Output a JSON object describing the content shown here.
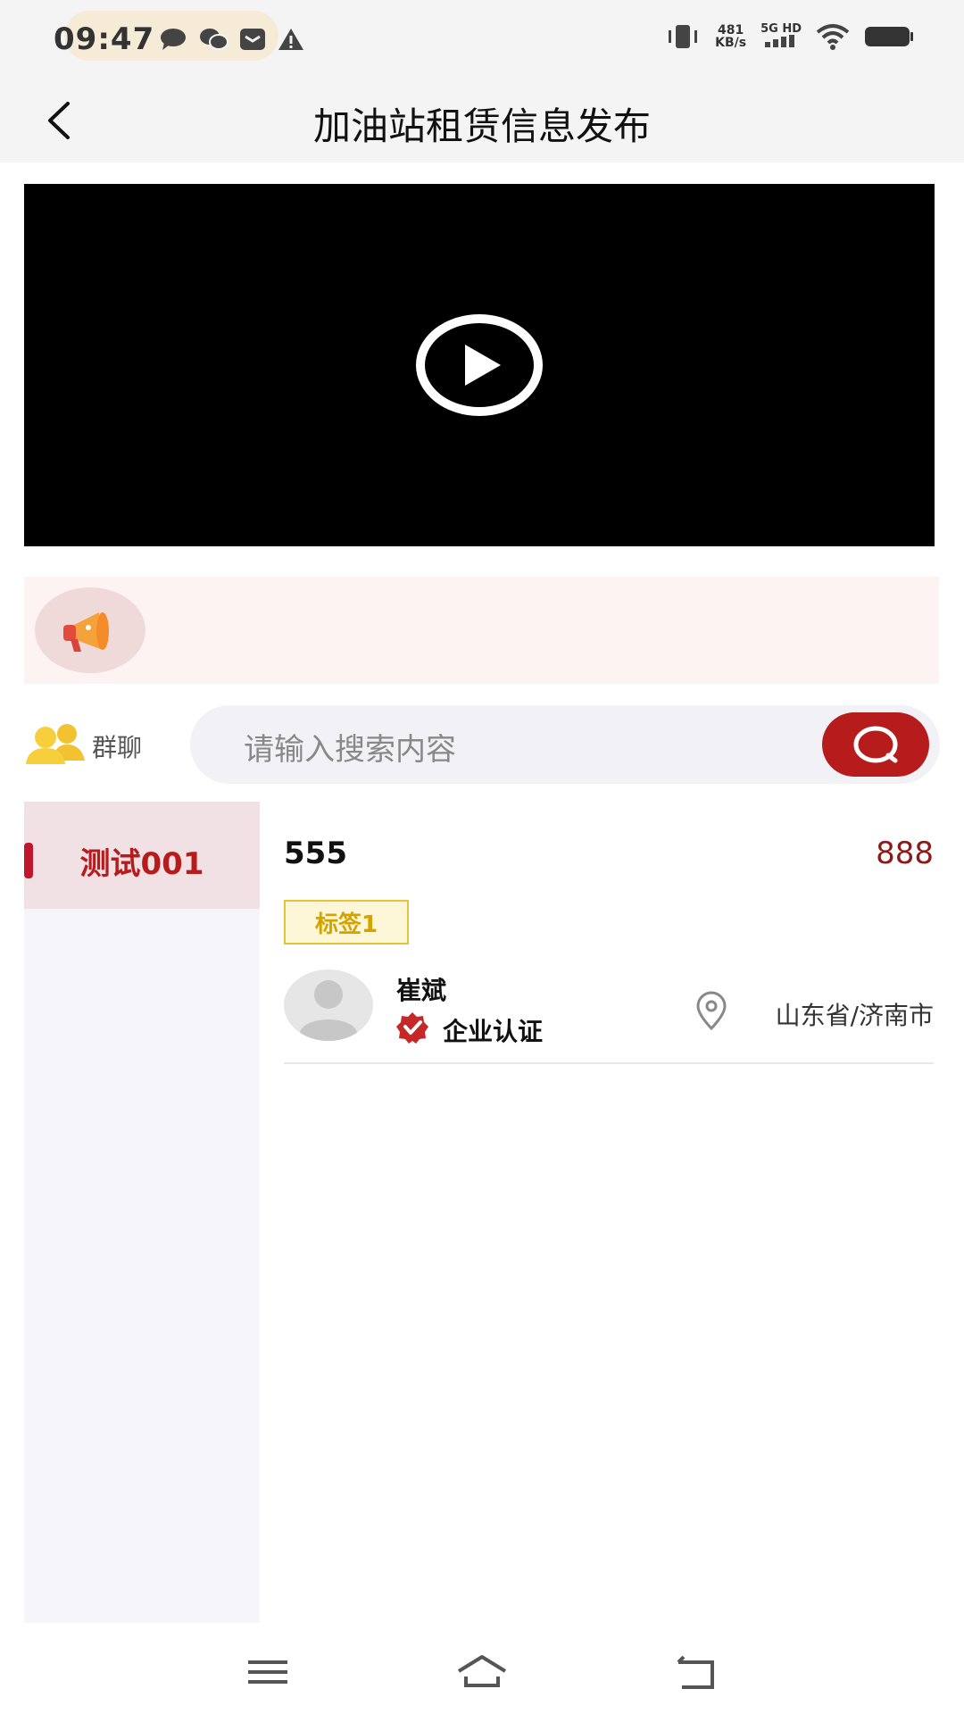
{
  "status_bar": {
    "time": "09:47",
    "speed_value": "481",
    "speed_unit": "KB/s",
    "network_label": "5G HD"
  },
  "header": {
    "title": "加油站租赁信息发布"
  },
  "search": {
    "group_label": "群聊",
    "placeholder": "请输入搜索内容"
  },
  "sidebar": {
    "items": [
      {
        "label": "测试001",
        "active": true
      }
    ]
  },
  "listing": {
    "title": "555",
    "price": "888",
    "tag": "标签1",
    "author": "崔斌",
    "verification": "企业认证",
    "location": "山东省/济南市"
  },
  "colors": {
    "accent": "#b71c1c",
    "tag_border": "#e6c43a",
    "tag_text": "#d4a300"
  }
}
